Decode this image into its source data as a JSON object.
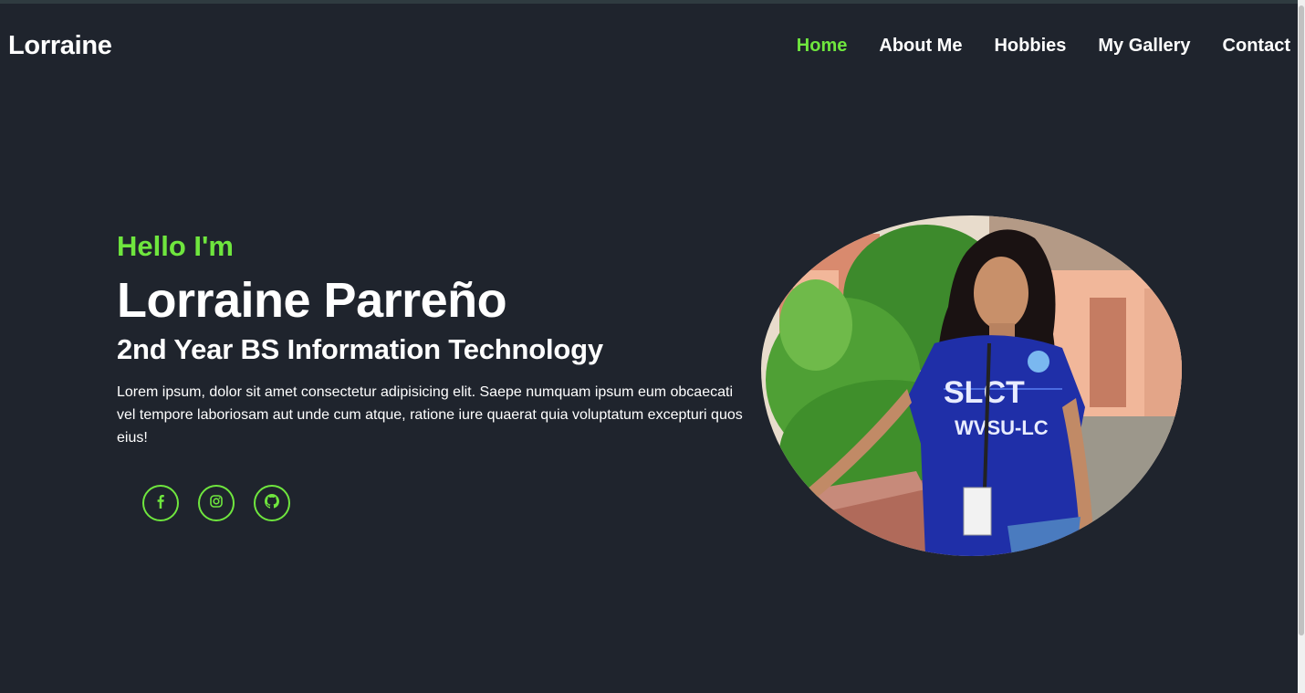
{
  "header": {
    "logo": "Lorraine",
    "nav": [
      {
        "label": "Home",
        "active": true
      },
      {
        "label": "About Me",
        "active": false
      },
      {
        "label": "Hobbies",
        "active": false
      },
      {
        "label": "My Gallery",
        "active": false
      },
      {
        "label": "Contact",
        "active": false
      }
    ]
  },
  "hero": {
    "greeting": "Hello I'm",
    "name": "Lorraine Parreño",
    "role": "2nd Year BS Information Technology",
    "description": "Lorem ipsum, dolor sit amet consectetur adipisicing elit. Saepe numquam ipsum eum obcaecati vel tempore laboriosam aut unde cum atque, ratione iure quaerat quia voluptatum excepturi quos eius!",
    "socials": [
      {
        "icon": "facebook-icon"
      },
      {
        "icon": "instagram-icon"
      },
      {
        "icon": "github-icon"
      }
    ],
    "photo": {
      "shirt_text": "SLCT",
      "shirt_text_2": "WVSU-LC"
    }
  },
  "colors": {
    "background": "#1f242d",
    "accent": "#6fe63e",
    "text": "#ffffff"
  }
}
